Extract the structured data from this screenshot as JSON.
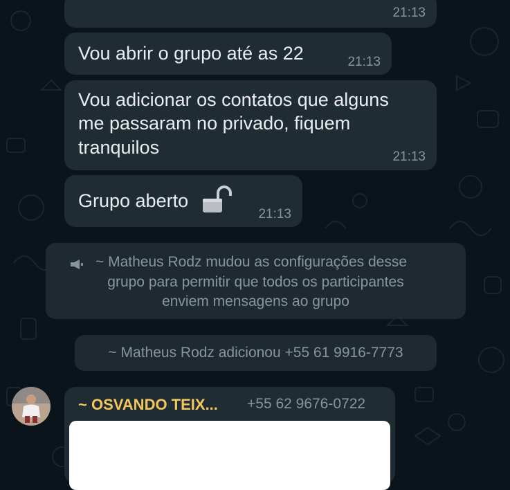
{
  "messages": [
    {
      "text": "",
      "time": "21:13"
    },
    {
      "text": "Vou abrir o grupo até as 22",
      "time": "21:13"
    },
    {
      "lines": [
        "Vou adicionar os contatos que alguns",
        "me passaram no privado, fiquem",
        "tranquilos"
      ],
      "time": "21:13"
    },
    {
      "text": "Grupo aberto",
      "icon": "unlocked-padlock-icon",
      "time": "21:13"
    }
  ],
  "system_messages": [
    {
      "icon": "megaphone-icon",
      "lines": [
        "~ Matheus Rodz mudou as configurações desse",
        "grupo para permitir que todos os participantes",
        "enviem mensagens ao grupo"
      ]
    },
    {
      "text": "~ Matheus Rodz adicionou +55 61 9916-7773"
    }
  ],
  "incoming": {
    "sender_name": "~ OSVANDO TEIX...",
    "sender_phone": "+55 62 9676-0722",
    "avatar": "user-avatar-photo"
  },
  "colors": {
    "background": "#0b141a",
    "bubble": "#202c33",
    "text": "#e9edef",
    "meta": "#8696a0",
    "sender_name": "#f4c75a"
  }
}
